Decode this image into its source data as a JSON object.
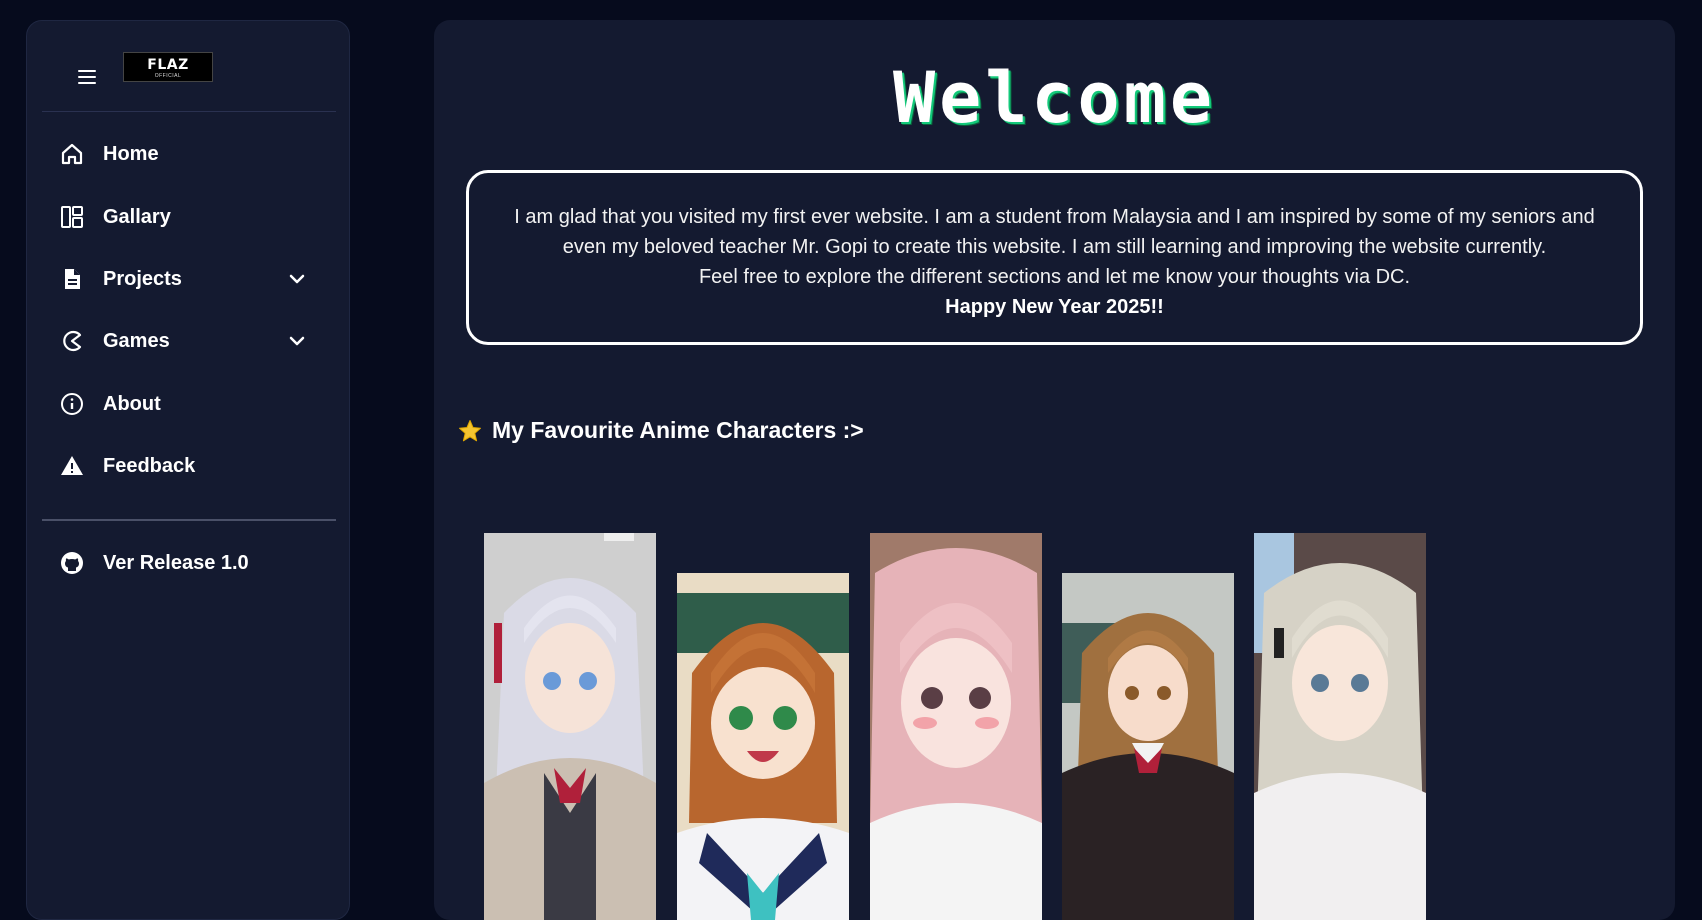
{
  "sidebar": {
    "logo": {
      "main": "FLAZ",
      "sub": "OFFICIAL"
    },
    "items": [
      {
        "label": "Home",
        "icon": "home-icon"
      },
      {
        "label": "Gallary",
        "icon": "gallery-icon"
      },
      {
        "label": "Projects",
        "icon": "document-icon",
        "expandable": true
      },
      {
        "label": "Games",
        "icon": "pacman-icon",
        "expandable": true
      },
      {
        "label": "About",
        "icon": "info-icon"
      },
      {
        "label": "Feedback",
        "icon": "warning-icon"
      }
    ],
    "footer_item": {
      "label": "Ver Release 1.0",
      "icon": "github-icon"
    }
  },
  "main": {
    "title": "Welcome",
    "intro": {
      "line1": "I am glad that you visited my first ever website. I am a student from Malaysia and I am inspired by some of my seniors and",
      "line2": "even my beloved teacher Mr. Gopi to create this website. I am still learning and improving the website currently.",
      "line3": "Feel free to explore the different sections and let me know your thoughts via DC.",
      "line4": "Happy New Year 2025!!"
    },
    "favourites_title": "My Favourite Anime Characters :>",
    "favourites_icon": "star-icon",
    "characters": [
      {
        "name": "silver-hair-schoolgirl",
        "hair": "#d9d9e6",
        "bg": "#cfcfcf"
      },
      {
        "name": "brown-hair-sailor-girl",
        "hair": "#b8662e",
        "bg": "#e9dcc5"
      },
      {
        "name": "pink-hair-girl",
        "hair": "#e6b3b8",
        "bg": "#a07a6a"
      },
      {
        "name": "brown-hair-blazer-girl",
        "hair": "#a0703f",
        "bg": "#c4c8c4"
      },
      {
        "name": "silver-hair-white-dress-girl",
        "hair": "#d6d2c6",
        "bg": "#5a4a48"
      }
    ]
  },
  "colors": {
    "page_bg": "#060b1d",
    "panel_bg": "#141a30",
    "accent_green": "#12c97a",
    "star": "#f4c430"
  }
}
